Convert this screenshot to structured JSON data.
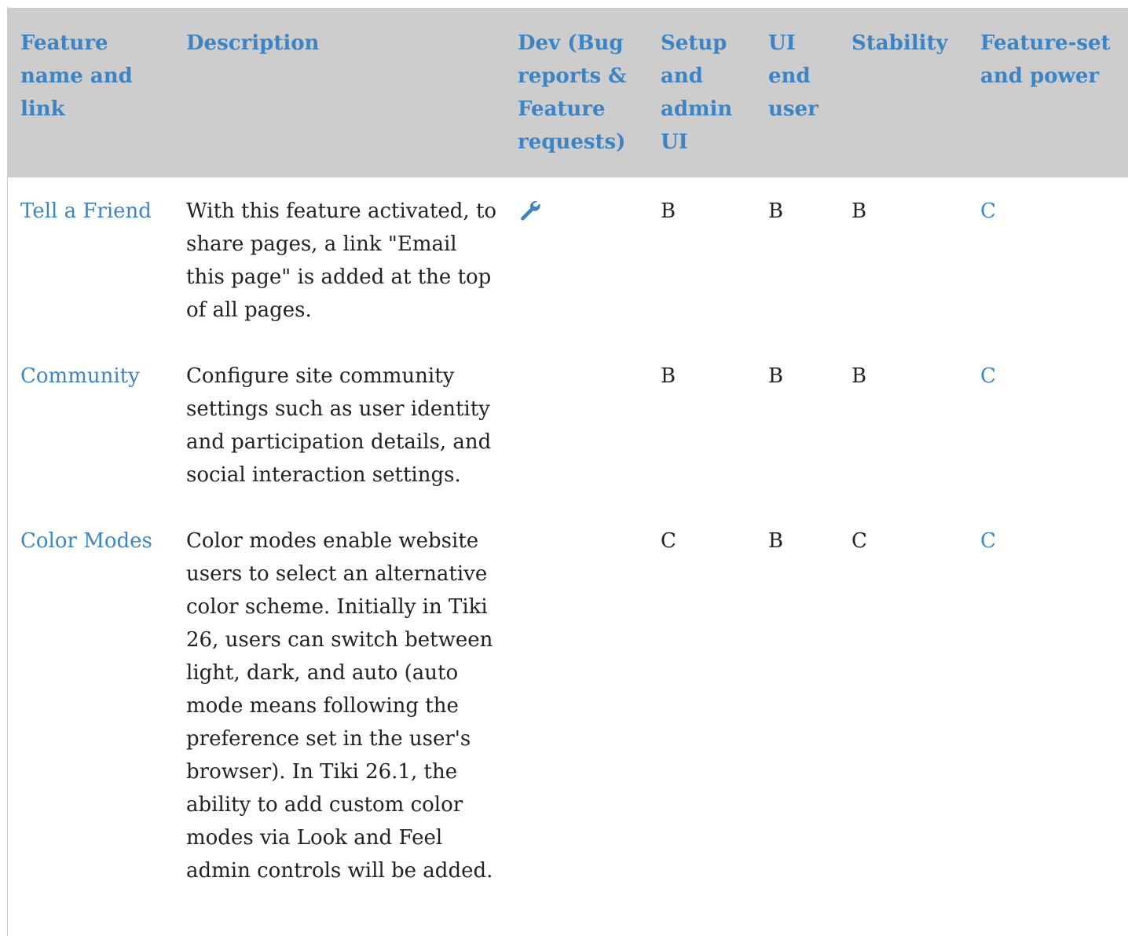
{
  "colors": {
    "header_bg": "#cdcdcd",
    "link": "#3d84c4",
    "text": "#222222"
  },
  "table": {
    "headers": [
      "Feature name and link",
      "Description",
      "Dev (Bug reports & Feature requests)",
      "Setup and admin UI",
      "UI end user",
      "Stability",
      "Feature-set and power"
    ],
    "rows": [
      {
        "name": "Tell a Friend",
        "description": "With this feature activated, to share pages, a link \"Email this page\" is added at the top of all pages.",
        "dev_icon": "wrench-icon",
        "setup": "B",
        "ui": "B",
        "stability": "B",
        "power": "C"
      },
      {
        "name": "Community",
        "description": "Configure site community settings such as user identity and participation details, and social interaction settings.",
        "setup": "B",
        "ui": "B",
        "stability": "B",
        "power": "C"
      },
      {
        "name": "Color Modes",
        "description": "Color modes enable website users to select an alternative color scheme. Initially in Tiki 26, users can switch between light, dark, and auto (auto mode means following the preference set in the user's browser). In Tiki 26.1, the ability to add custom color modes via Look and Feel admin controls will be added.",
        "setup": "C",
        "ui": "B",
        "stability": "C",
        "power": "C"
      }
    ]
  }
}
